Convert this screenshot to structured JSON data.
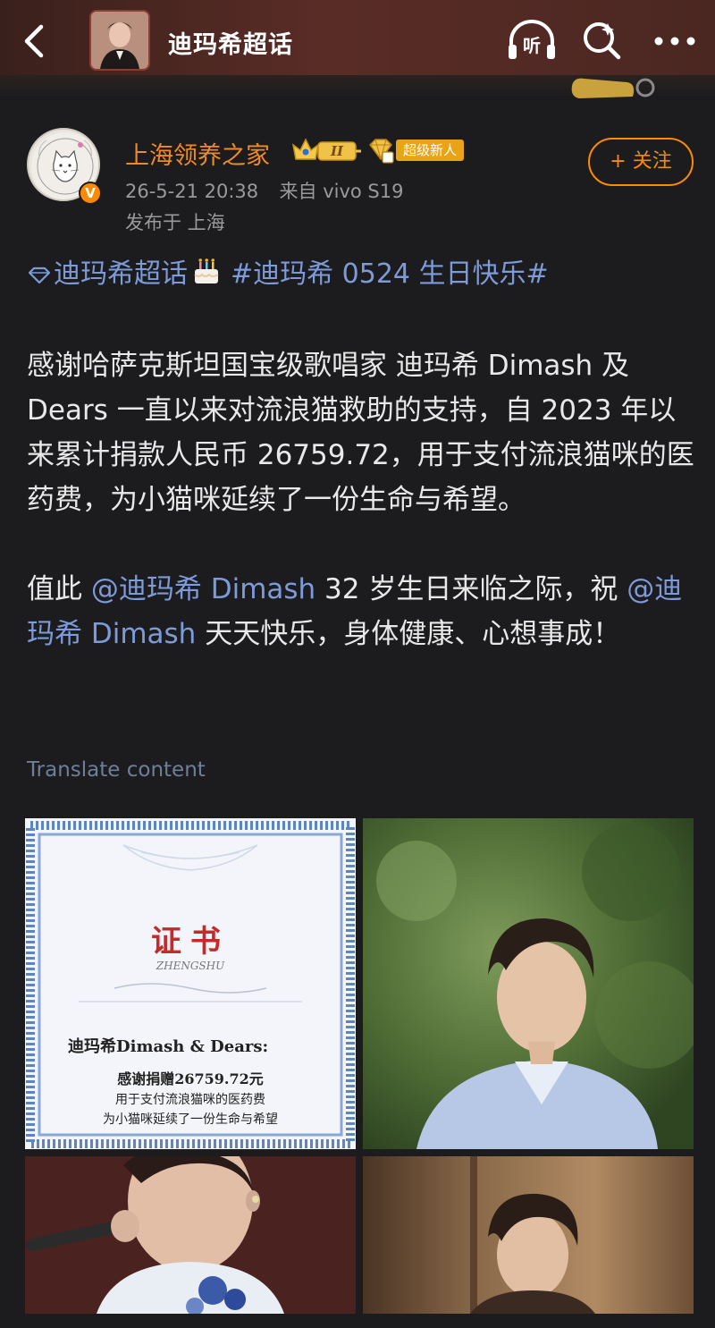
{
  "topbar": {
    "title": "迪玛希超话",
    "icons": [
      "back-arrow-icon",
      "listen-icon",
      "search-icon",
      "more-icon"
    ],
    "listen_label": "听"
  },
  "post": {
    "username": "上海领养之家",
    "badges": {
      "crown_level": "II",
      "newbie_label": "超级新人"
    },
    "verified_mark": "V",
    "timestamp": "26-5-21 20:38",
    "source": "来自 vivo S19",
    "location": "发布于 上海",
    "follow_label": "+ 关注",
    "tags": {
      "supertopic": "迪玛希超话",
      "hashtag": "#迪玛希 0524 生日快乐#"
    },
    "body_p1": "感谢哈萨克斯坦国宝级歌唱家 迪玛希 Dimash 及 Dears 一直以来对流浪猫救助的支持，自 2023 年以来累计捐款人民币 26759.72，用于支付流浪猫咪的医药费，为小猫咪延续了一份生命与希望。",
    "body_p2_a": "值此 ",
    "mention_1": "@迪玛希 Dimash",
    "body_p2_b": " 32 岁生日来临之际，祝 ",
    "mention_2": "@迪玛希 Dimash",
    "body_p2_c": " 天天快乐，身体健康、心想事成！",
    "translate_label": "Translate content"
  },
  "certificate": {
    "title": "证书",
    "pinyin": "ZHENGSHU",
    "recipient": "迪玛希Dimash & Dears:",
    "line1": "感谢捐赠26759.72元",
    "line2": "用于支付流浪猫咪的医药费",
    "line3": "为小猫咪延续了一份生命与希望"
  },
  "colors": {
    "accent_orange": "#ff8a00",
    "username_orange": "#f08a24",
    "link_blue": "#7d9bd9",
    "background": "#1c1c1e"
  }
}
